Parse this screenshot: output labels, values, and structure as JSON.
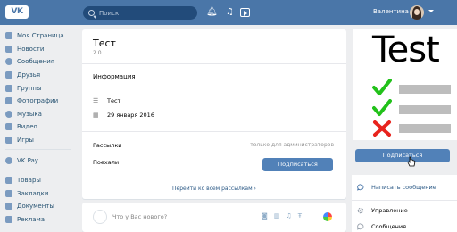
{
  "header": {
    "logo_text": "VK",
    "search_placeholder": "Поиск",
    "username": "Валентина"
  },
  "sidebar": {
    "items": [
      {
        "label": "Моя Страница",
        "icon": "home-icon"
      },
      {
        "label": "Новости",
        "icon": "news-icon"
      },
      {
        "label": "Сообщения",
        "icon": "messages-icon"
      },
      {
        "label": "Друзья",
        "icon": "friends-icon"
      },
      {
        "label": "Группы",
        "icon": "groups-icon"
      },
      {
        "label": "Фотографии",
        "icon": "photos-icon"
      },
      {
        "label": "Музыка",
        "icon": "music-icon"
      },
      {
        "label": "Видео",
        "icon": "video-icon"
      },
      {
        "label": "Игры",
        "icon": "games-icon"
      }
    ],
    "items2": [
      {
        "label": "VK Pay",
        "icon": "vkpay-icon"
      }
    ],
    "items3": [
      {
        "label": "Товары",
        "icon": "goods-icon"
      },
      {
        "label": "Закладки",
        "icon": "bookmarks-icon"
      },
      {
        "label": "Документы",
        "icon": "documents-icon"
      },
      {
        "label": "Реклама",
        "icon": "ads-icon"
      }
    ]
  },
  "group": {
    "title": "Тест",
    "subtitle": "2.0",
    "info_heading": "Информация",
    "description": "Тест",
    "date": "29 января 2016"
  },
  "mailing": {
    "heading": "Рассылки",
    "admin_note": "только для администраторов",
    "name": "Поехали!",
    "subscribe_label": "Подписаться",
    "all_link": "Перейти ко всем рассылкам"
  },
  "post": {
    "placeholder": "Что у Вас нового?"
  },
  "promo": {
    "title": "Test"
  },
  "right": {
    "subscribe_label": "Подписаться",
    "write_message": "Написать сообщение",
    "manage": "Управление",
    "messages": "Сообщения"
  },
  "colors": {
    "header": "#4a76a8",
    "button": "#5181b8",
    "link": "#2a5885",
    "check": "#22c11a",
    "cross": "#e8231d"
  }
}
